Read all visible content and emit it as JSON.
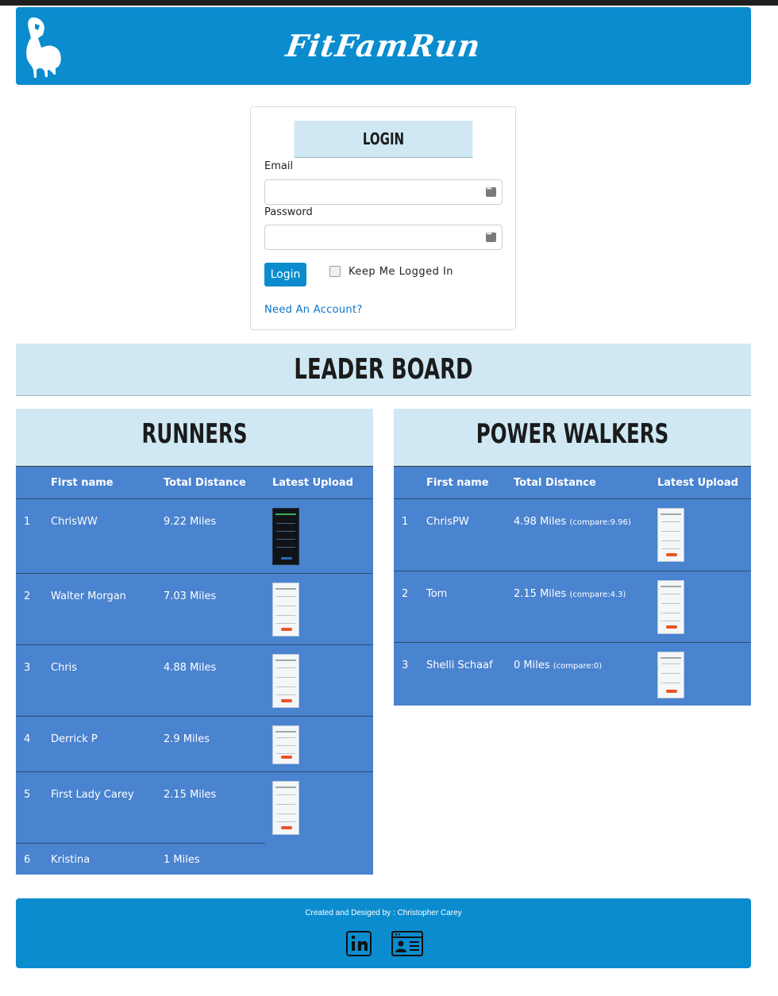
{
  "header": {
    "brand": "FitFamRun",
    "logo_icon": "flexed-arm-icon"
  },
  "login": {
    "title": "LOGIN",
    "email_label": "Email",
    "email_value": "",
    "password_label": "Password",
    "password_value": "",
    "submit_label": "Login",
    "remember_label": "Keep Me Logged In",
    "remember_checked": false,
    "signup_link": "Need An Account?"
  },
  "leaderboard": {
    "title": "LEADER BOARD",
    "runners": {
      "title": "RUNNERS",
      "columns": [
        "First name",
        "Total Distance",
        "Latest Upload"
      ],
      "rows": [
        {
          "rank": "1",
          "name": "ChrisWW",
          "distance": "9.22 Miles",
          "has_upload": true,
          "upload_theme": "dark"
        },
        {
          "rank": "2",
          "name": "Walter Morgan",
          "distance": "7.03 Miles",
          "has_upload": true,
          "upload_theme": "light"
        },
        {
          "rank": "3",
          "name": "Chris",
          "distance": "4.88 Miles",
          "has_upload": true,
          "upload_theme": "light"
        },
        {
          "rank": "4",
          "name": "Derrick P",
          "distance": "2.9 Miles",
          "has_upload": true,
          "upload_theme": "light"
        },
        {
          "rank": "5",
          "name": "First Lady Carey",
          "distance": "2.15 Miles",
          "has_upload": true,
          "upload_theme": "light"
        },
        {
          "rank": "6",
          "name": "Kristina",
          "distance": "1 Miles",
          "has_upload": false
        }
      ]
    },
    "walkers": {
      "title": "POWER WALKERS",
      "columns": [
        "First name",
        "Total Distance",
        "Latest Upload"
      ],
      "rows": [
        {
          "rank": "1",
          "name": "ChrisPW",
          "distance": "4.98 Miles",
          "compare": "(compare:9.96)",
          "has_upload": true,
          "upload_theme": "light"
        },
        {
          "rank": "2",
          "name": "Tom",
          "distance": "2.15 Miles",
          "compare": "(compare:4.3)",
          "has_upload": true,
          "upload_theme": "light"
        },
        {
          "rank": "3",
          "name": "Shelli Schaaf",
          "distance": "0 Miles",
          "compare": "(compare:0)",
          "has_upload": true,
          "upload_theme": "light"
        }
      ]
    }
  },
  "footer": {
    "credit": "Created and Desiged by : Christopher Carey",
    "icons": [
      "linkedin-icon",
      "resume-card-icon"
    ]
  },
  "colors": {
    "brand_blue": "#0a8ccf",
    "panel_blue": "#4a83cf",
    "light_header": "#cfe8f3"
  }
}
